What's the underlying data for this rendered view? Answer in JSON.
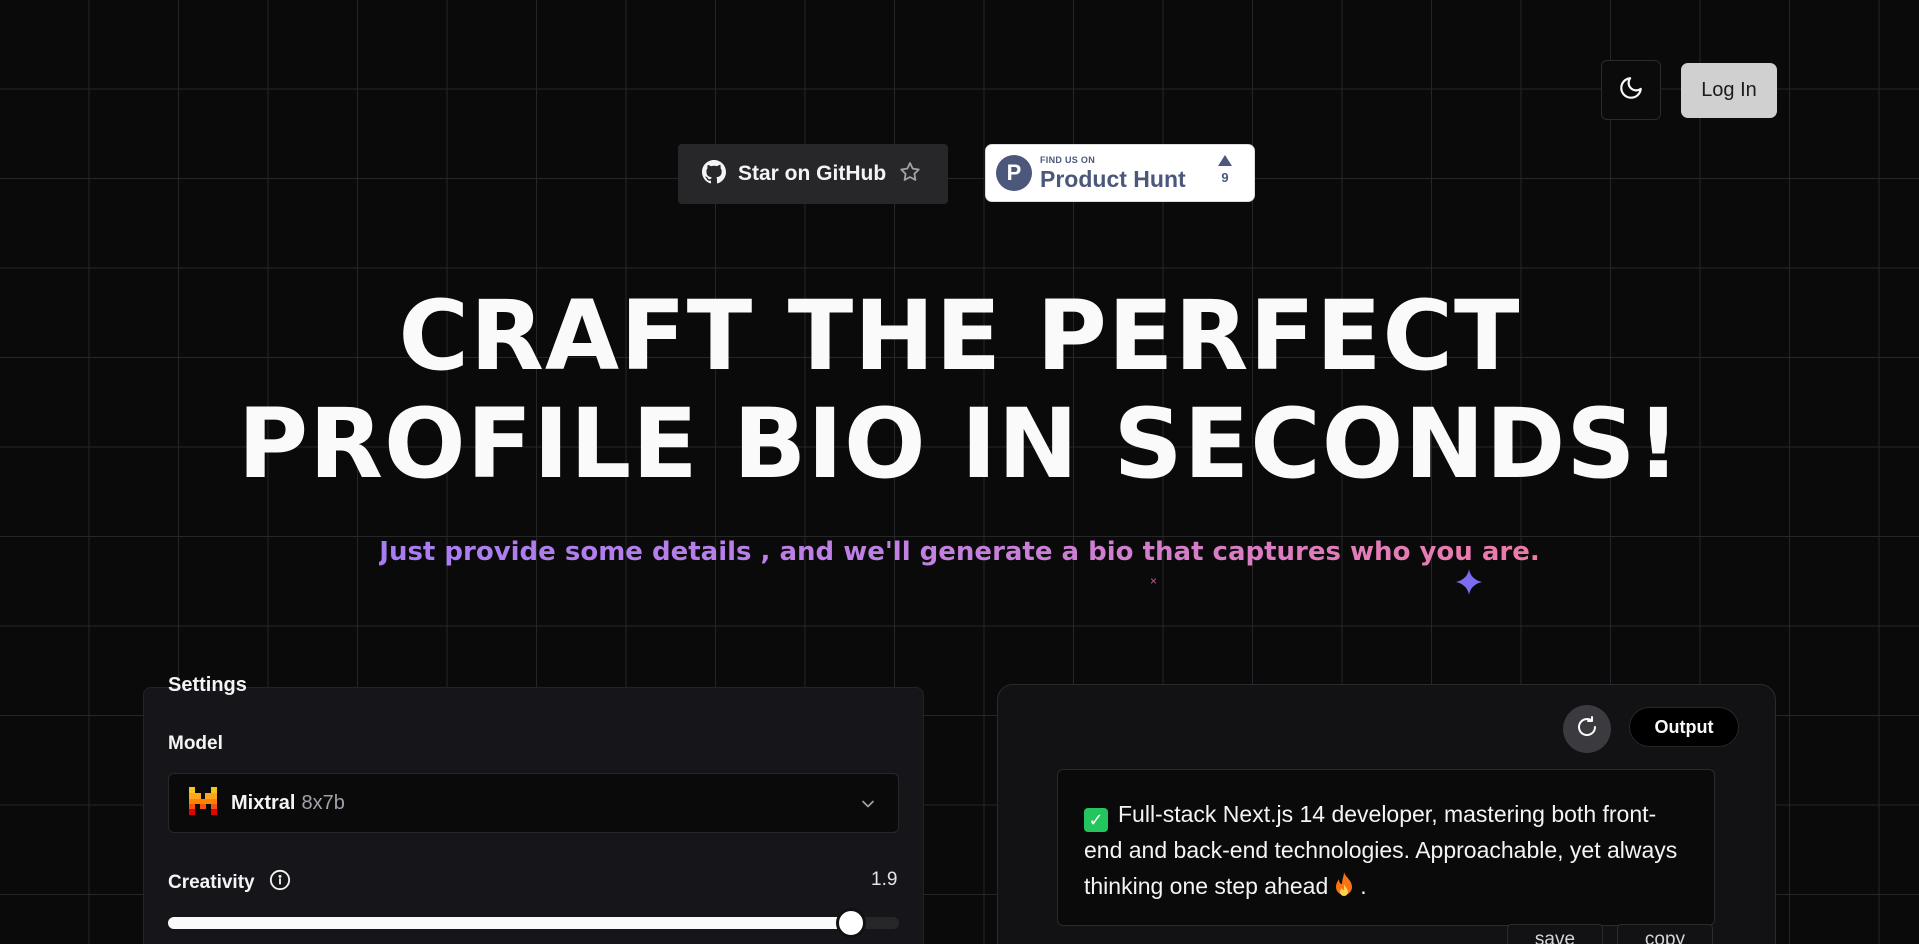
{
  "header": {
    "login_label": "Log In",
    "theme_icon": "moon-icon"
  },
  "badges": {
    "github_label": "Star on GitHub",
    "producthunt": {
      "find_text": "FIND US ON",
      "name": "Product Hunt",
      "logo_letter": "P",
      "votes": "9"
    }
  },
  "hero": {
    "title_line1": "CRAFT THE PERFECT",
    "title_line2": "PROFILE BIO IN SECONDS!",
    "subtitle": "Just provide some details , and we'll generate a bio that captures who you are."
  },
  "settings": {
    "legend": "Settings",
    "model_label": "Model",
    "model_name": "Mixtral",
    "model_size": "8x7b",
    "creativity_label": "Creativity",
    "creativity_value": "1.9",
    "creativity_fraction": 0.935
  },
  "output": {
    "badge": "Output",
    "text": "Full-stack Next.js 14 developer, mastering both front-end and back-end technologies. Approachable, yet always thinking one step ahead",
    "text_end": ".",
    "save_label": "save",
    "copy_label": "copy"
  },
  "colors": {
    "accent_gradient_start": "#a97cf2",
    "accent_gradient_end": "#f07aa8",
    "check_green": "#22c55e",
    "ph_blue": "#4b587c"
  }
}
